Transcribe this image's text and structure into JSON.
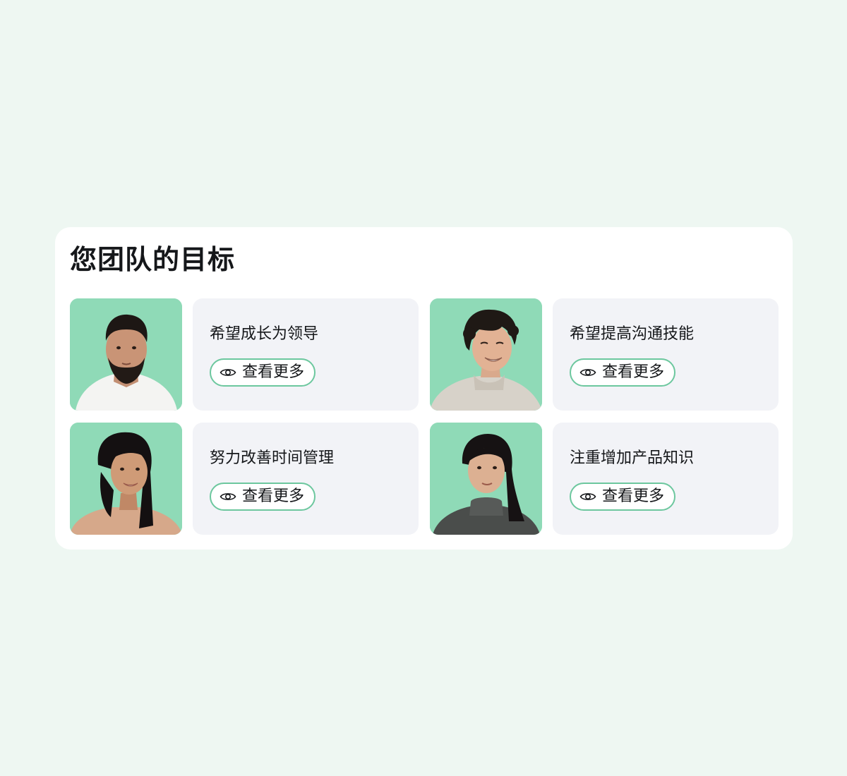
{
  "panel": {
    "title": "您团队的目标"
  },
  "goals": [
    {
      "text": "希望成长为领导",
      "button_label": "查看更多",
      "avatar": "man-beard-white-shirt"
    },
    {
      "text": "希望提高沟通技能",
      "button_label": "查看更多",
      "avatar": "man-curly-hair-sweater"
    },
    {
      "text": "努力改善时间管理",
      "button_label": "查看更多",
      "avatar": "woman-long-hair-beige-sweater"
    },
    {
      "text": "注重增加产品知识",
      "button_label": "查看更多",
      "avatar": "woman-dark-hair-grey-turtleneck"
    }
  ],
  "colors": {
    "page_background": "#eef7f2",
    "avatar_background": "#8fdab7",
    "card_background": "#f2f3f7",
    "button_border": "#6cc79e"
  },
  "icons": {
    "more_button": "eye-icon"
  }
}
